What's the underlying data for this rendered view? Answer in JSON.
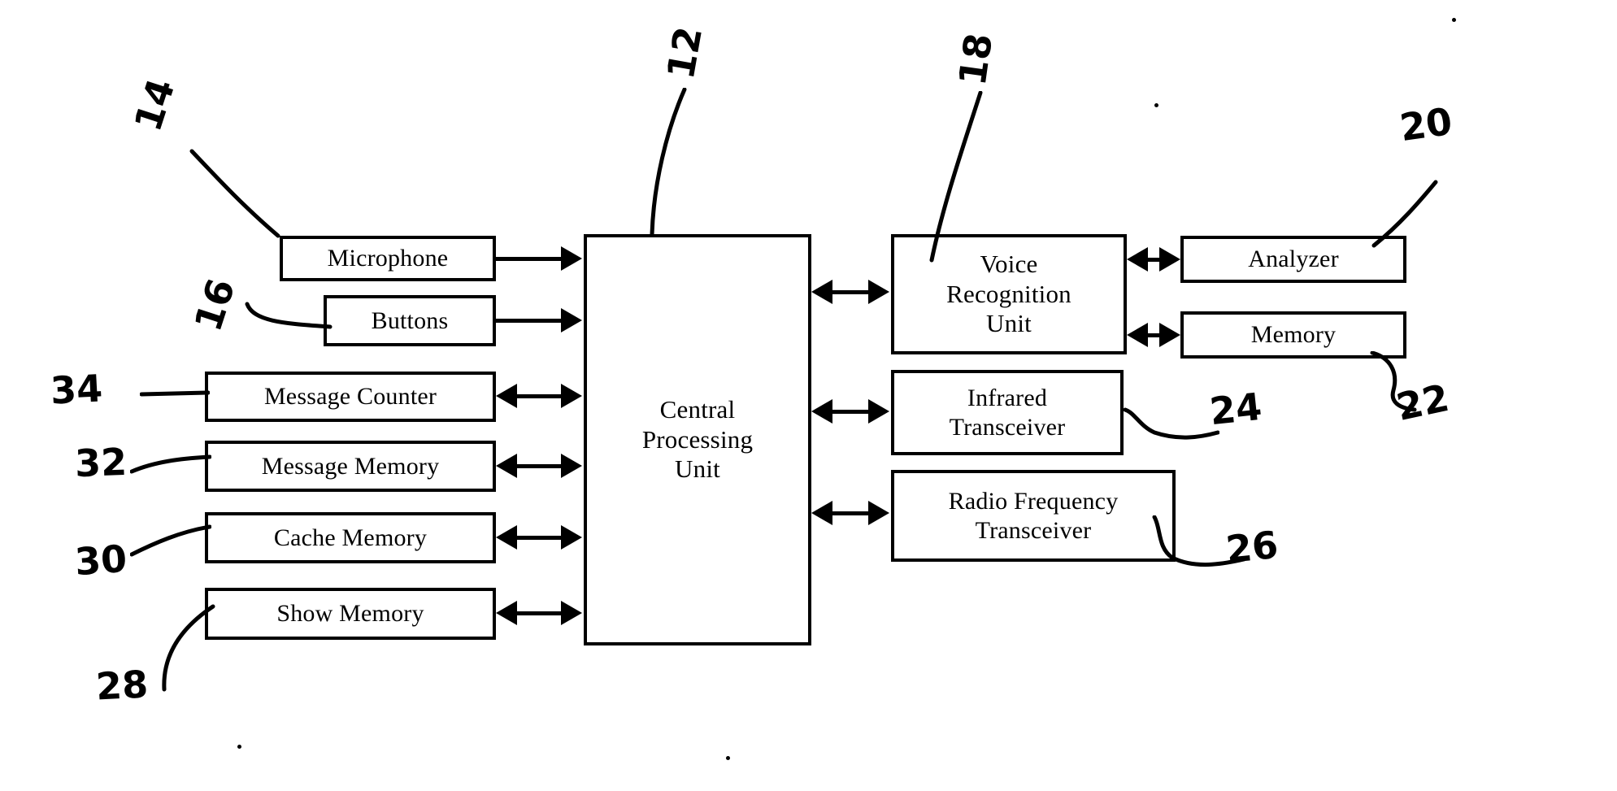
{
  "figure": {
    "type": "patent-block-diagram",
    "background_color": "#ffffff",
    "line_color": "#000000"
  },
  "blocks": {
    "microphone": {
      "label": "Microphone",
      "ref": "14"
    },
    "buttons": {
      "label": "Buttons",
      "ref": "16"
    },
    "message_counter": {
      "label": "Message Counter",
      "ref": "34"
    },
    "message_memory": {
      "label": "Message Memory",
      "ref": "32"
    },
    "cache_memory": {
      "label": "Cache Memory",
      "ref": "30"
    },
    "show_memory": {
      "label": "Show Memory",
      "ref": "28"
    },
    "cpu": {
      "label": "Central\nProcessing\nUnit",
      "ref": "12"
    },
    "voice_recognition": {
      "label": "Voice\nRecognition\nUnit",
      "ref": "18"
    },
    "analyzer": {
      "label": "Analyzer",
      "ref": "20"
    },
    "memory": {
      "label": "Memory",
      "ref": "22"
    },
    "infrared": {
      "label": "Infrared\nTransceiver",
      "ref": "24"
    },
    "radio_frequency": {
      "label": "Radio Frequency\nTransceiver",
      "ref": "26"
    }
  },
  "reference_numerals": {
    "n12": "12",
    "n14": "14",
    "n16": "16",
    "n18": "18",
    "n20": "20",
    "n22": "22",
    "n24": "24",
    "n26": "26",
    "n28": "28",
    "n30": "30",
    "n32": "32",
    "n34": "34"
  },
  "connections": [
    {
      "from": "microphone",
      "to": "cpu",
      "direction": "one-way"
    },
    {
      "from": "buttons",
      "to": "cpu",
      "direction": "one-way"
    },
    {
      "from": "message_counter",
      "to": "cpu",
      "direction": "two-way"
    },
    {
      "from": "message_memory",
      "to": "cpu",
      "direction": "two-way"
    },
    {
      "from": "cache_memory",
      "to": "cpu",
      "direction": "two-way"
    },
    {
      "from": "show_memory",
      "to": "cpu",
      "direction": "two-way"
    },
    {
      "from": "cpu",
      "to": "voice_recognition",
      "direction": "two-way"
    },
    {
      "from": "cpu",
      "to": "infrared",
      "direction": "two-way"
    },
    {
      "from": "cpu",
      "to": "radio_frequency",
      "direction": "two-way"
    },
    {
      "from": "voice_recognition",
      "to": "analyzer",
      "direction": "two-way"
    },
    {
      "from": "voice_recognition",
      "to": "memory",
      "direction": "two-way"
    }
  ]
}
